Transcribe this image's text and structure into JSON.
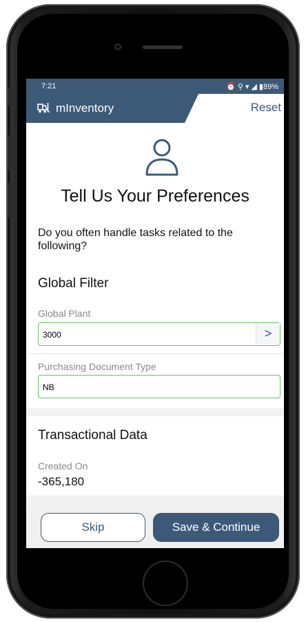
{
  "status_bar": {
    "time": "7:21",
    "icons_text": "⏰ ⚲ ᵛᵒ ▾ ◢ ▮89%",
    "battery": "89%"
  },
  "app_bar": {
    "brand_icon": "forklift-icon",
    "title": "mInventory",
    "reset_label": "Reset"
  },
  "header": {
    "icon": "person-icon",
    "title": "Tell Us Your Preferences",
    "question": "Do you often handle tasks related to the following?"
  },
  "global_filter": {
    "title": "Global Filter",
    "plant_label": "Global Plant",
    "plant_value": "3000",
    "plant_chevron": ">",
    "doc_type_label": "Purchasing Document Type",
    "doc_type_value": "NB"
  },
  "transactional_data": {
    "title": "Transactional Data",
    "created_on_label": "Created On",
    "created_on_value": "-365,180"
  },
  "footer": {
    "skip_label": "Skip",
    "save_label": "Save & Continue"
  },
  "colors": {
    "primary": "#3c5a78",
    "field_border": "#62c462",
    "label_gray": "#8a8a8a"
  }
}
